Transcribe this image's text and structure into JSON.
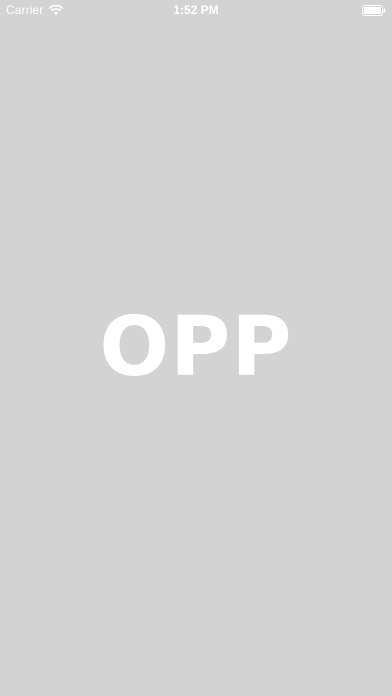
{
  "status_bar": {
    "carrier": "Carrier",
    "time": "1:52 PM",
    "wifi_icon": "wifi-icon",
    "battery_icon": "battery-icon",
    "text_color": "#ffffff"
  },
  "splash": {
    "logo_text": "OPP",
    "logo_color": "#ffffff",
    "background_color": "#d3d3d3"
  }
}
